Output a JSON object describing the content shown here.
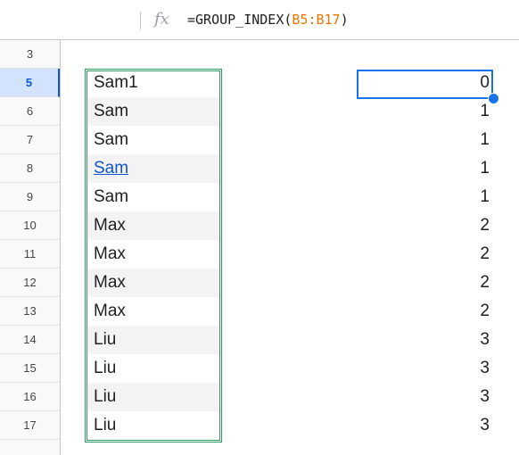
{
  "formula_bar": {
    "fx_label": "fx",
    "formula_prefix": "=GROUP_INDEX(",
    "formula_range": "B5:B17",
    "formula_suffix": ")"
  },
  "rows": [
    {
      "num": "3",
      "name": "",
      "value": "",
      "shaded": false,
      "link": false,
      "active": false
    },
    {
      "num": "5",
      "name": "Sam1",
      "value": "0",
      "shaded": false,
      "link": false,
      "active": true
    },
    {
      "num": "6",
      "name": "Sam",
      "value": "1",
      "shaded": true,
      "link": false,
      "active": false
    },
    {
      "num": "7",
      "name": "Sam",
      "value": "1",
      "shaded": false,
      "link": false,
      "active": false
    },
    {
      "num": "8",
      "name": "Sam",
      "value": "1",
      "shaded": true,
      "link": true,
      "active": false
    },
    {
      "num": "9",
      "name": "Sam",
      "value": "1",
      "shaded": false,
      "link": false,
      "active": false
    },
    {
      "num": "10",
      "name": "Max",
      "value": "2",
      "shaded": true,
      "link": false,
      "active": false
    },
    {
      "num": "11",
      "name": "Max",
      "value": "2",
      "shaded": false,
      "link": false,
      "active": false
    },
    {
      "num": "12",
      "name": "Max",
      "value": "2",
      "shaded": true,
      "link": false,
      "active": false
    },
    {
      "num": "13",
      "name": "Max",
      "value": "2",
      "shaded": false,
      "link": false,
      "active": false
    },
    {
      "num": "14",
      "name": "Liu",
      "value": "3",
      "shaded": true,
      "link": false,
      "active": false
    },
    {
      "num": "15",
      "name": "Liu",
      "value": "3",
      "shaded": false,
      "link": false,
      "active": false
    },
    {
      "num": "16",
      "name": "Liu",
      "value": "3",
      "shaded": true,
      "link": false,
      "active": false
    },
    {
      "num": "17",
      "name": "Liu",
      "value": "3",
      "shaded": false,
      "link": false,
      "active": false
    }
  ],
  "colors": {
    "range_highlight": "#2e9a5f",
    "selection": "#1a73e8",
    "formula_ref": "#e37400",
    "link": "#1155cc"
  }
}
